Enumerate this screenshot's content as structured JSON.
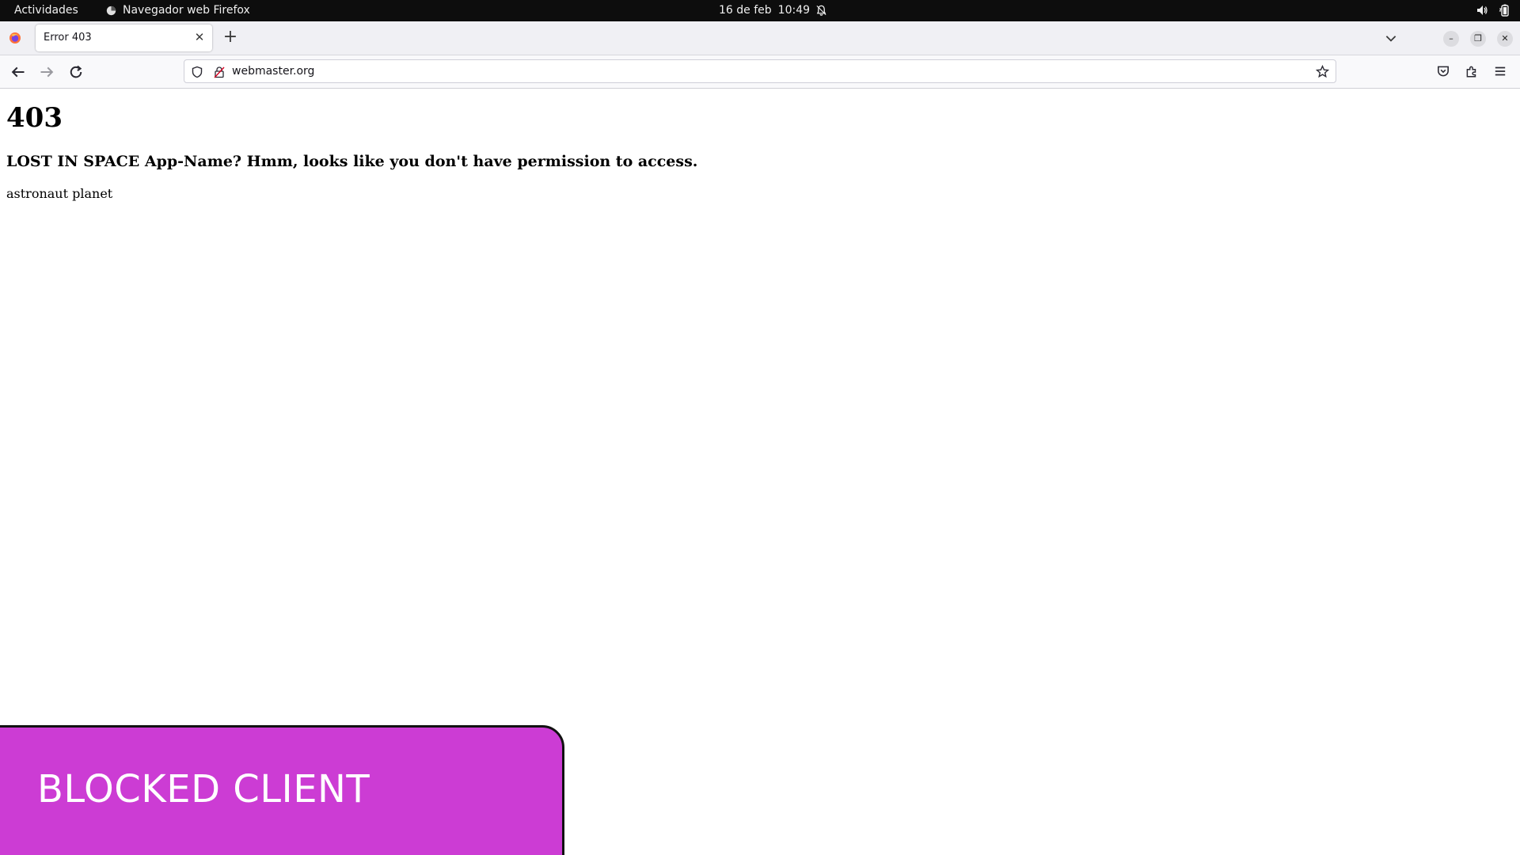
{
  "system_bar": {
    "activities": "Actividades",
    "app_name": "Navegador web Firefox",
    "date": "16 de feb",
    "time": "10:49"
  },
  "browser": {
    "tab_title": "Error 403",
    "url": "webmaster.org"
  },
  "page": {
    "code": "403",
    "message": "LOST IN SPACE App-Name? Hmm, looks like you don't have permission to access.",
    "image_alt": "astronaut planet",
    "banner": "BLOCKED CLIENT"
  },
  "colors": {
    "banner_bg": "#cc3cd4",
    "topbar_bg": "#0d0d0d"
  }
}
